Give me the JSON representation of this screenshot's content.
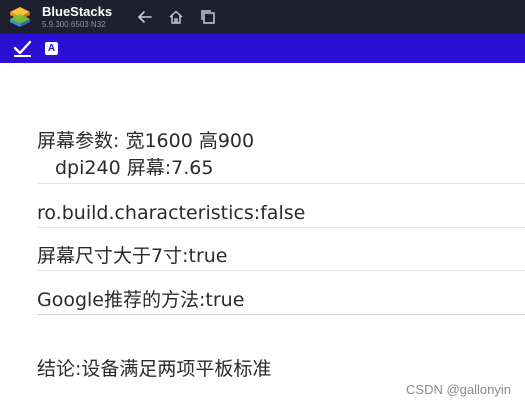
{
  "app": {
    "name": "BlueStacks",
    "version": "5.9.300.6503 N32",
    "logo_icon": "bluestacks-logo",
    "accent": "#1e2030"
  },
  "titlebar": {
    "back_icon": "back-arrow-icon",
    "home_icon": "home-icon",
    "recent_icon": "recent-apps-icon"
  },
  "statusbar": {
    "color": "#2d0fd4",
    "notification_icons": [
      "checkmark-icon",
      "a-icon"
    ],
    "a_label": "A"
  },
  "content": {
    "screen_params_line1": "屏幕参数: 宽1600 高900",
    "screen_params_line2": "dpi240 屏幕:7.65",
    "build_characteristics": "ro.build.characteristics:false",
    "screen_size_check": "屏幕尺寸大于7寸:true",
    "google_method": "Google推荐的方法:true",
    "conclusion": "结论:设备满足两项平板标准"
  },
  "watermark": "CSDN @gallonyin"
}
